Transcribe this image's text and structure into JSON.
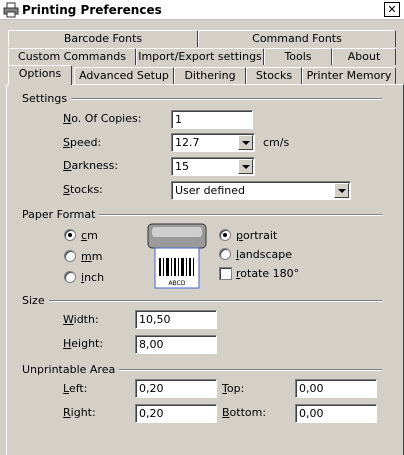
{
  "window": {
    "title": "Printing Preferences",
    "close_glyph": "✕"
  },
  "tabs": {
    "row1": [
      "Barcode Fonts",
      "Command Fonts"
    ],
    "row2": [
      "Custom Commands",
      "Import/Export settings",
      "Tools",
      "About"
    ],
    "row3": [
      "Options",
      "Advanced Setup",
      "Dithering",
      "Stocks",
      "Printer Memory"
    ],
    "active": "Options"
  },
  "settings": {
    "group_label": "Settings",
    "copies": {
      "label_u": "N",
      "label_rest": "o. Of Copies:",
      "value": "1"
    },
    "speed": {
      "label_u": "S",
      "label_rest": "peed:",
      "value": "12.7",
      "unit": "cm/s"
    },
    "darkness": {
      "label_u": "D",
      "label_rest": "arkness:",
      "value": "15"
    },
    "stocks": {
      "label_u": "S",
      "label_rest": "tocks:",
      "value": "User defined"
    }
  },
  "paper_format": {
    "group_label": "Paper Format",
    "units": [
      {
        "u": "c",
        "rest": "m",
        "checked": true
      },
      {
        "u": "m",
        "rest": "m",
        "checked": false
      },
      {
        "u": "i",
        "rest": "nch",
        "checked": false
      }
    ],
    "orientation": [
      {
        "u": "p",
        "rest": "ortrait",
        "checked": true
      },
      {
        "u": "l",
        "rest": "andscape",
        "checked": false
      }
    ],
    "rotate": {
      "u": "r",
      "rest": "otate 180°",
      "checked": false
    },
    "label_text": "ABCD"
  },
  "size": {
    "group_label": "Size",
    "width": {
      "label_u": "W",
      "label_rest": "idth:",
      "value": "10,50"
    },
    "height": {
      "label_u": "H",
      "label_rest": "eight:",
      "value": "8,00"
    }
  },
  "unprintable": {
    "group_label": "Unprintable Area",
    "left": {
      "label_u": "L",
      "label_rest": "eft:",
      "value": "0,20"
    },
    "top": {
      "label_u": "T",
      "label_rest": "op:",
      "value": "0,00"
    },
    "right": {
      "label_u": "R",
      "label_rest": "ight:",
      "value": "0,20"
    },
    "bottom": {
      "label_u": "B",
      "label_rest": "ottom:",
      "value": "0,00"
    }
  }
}
